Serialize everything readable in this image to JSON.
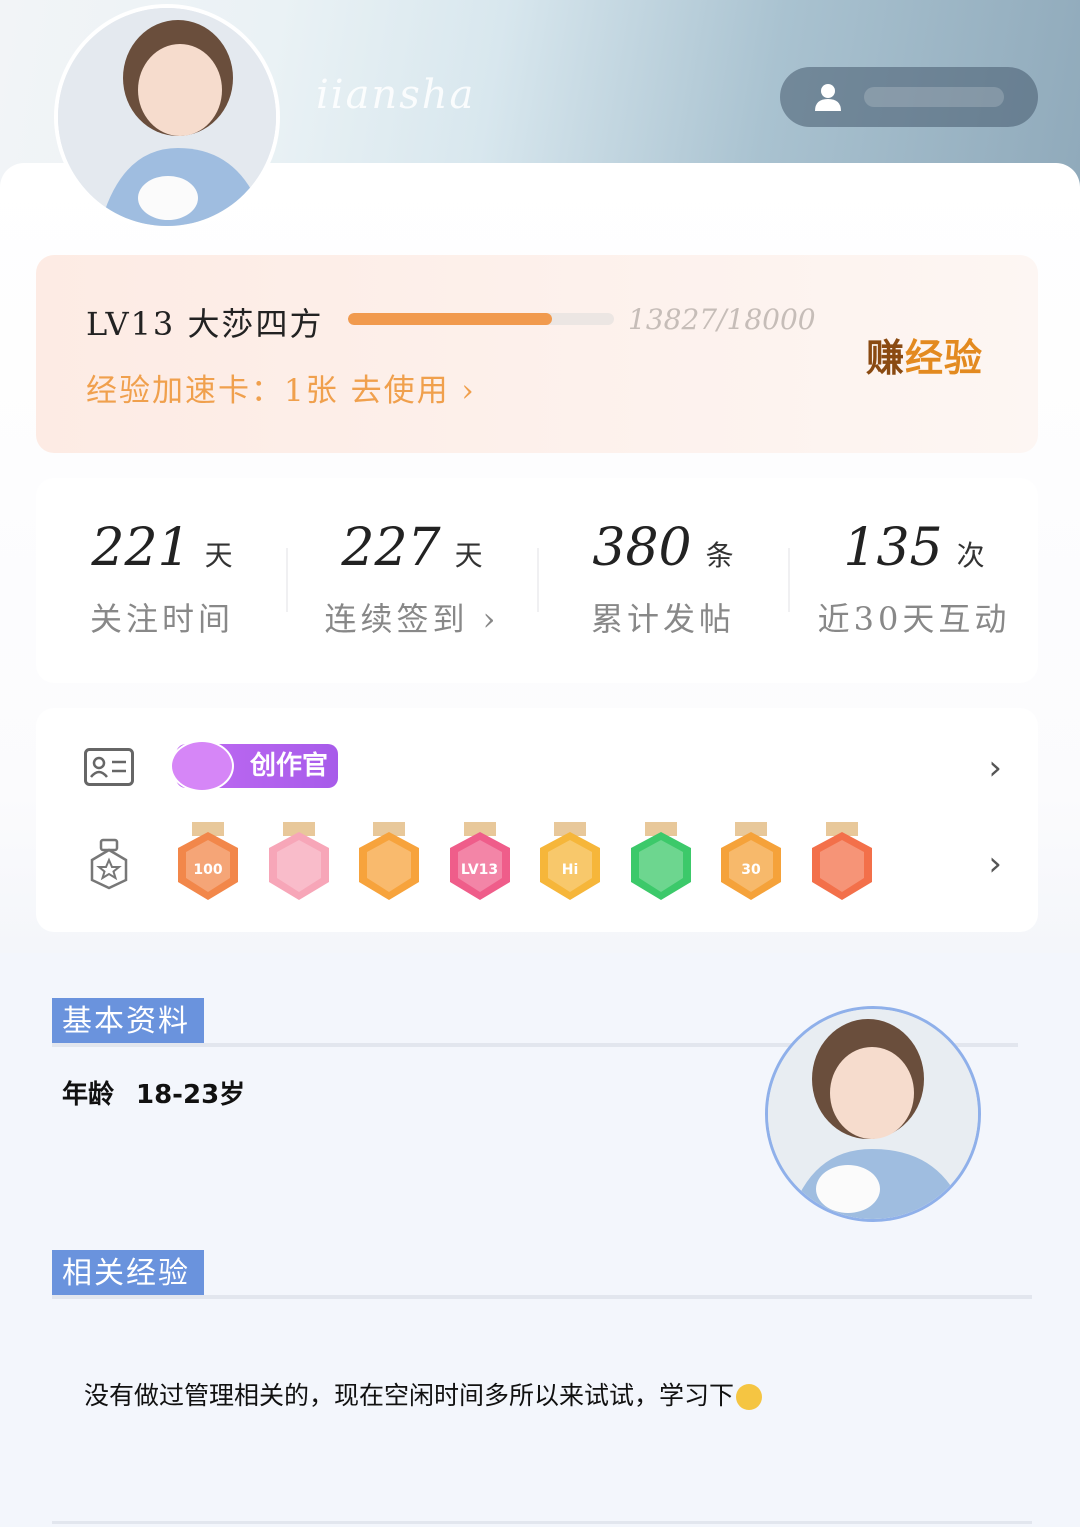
{
  "header": {
    "username": "iiansha"
  },
  "level": {
    "title": "LV13 大莎四方",
    "progress_value": "13827/18000",
    "progress_fraction": 0.768,
    "speed_card": "经验加速卡：1张 去使用 ›",
    "earn_label_first": "赚",
    "earn_label_rest": "经验"
  },
  "stats": [
    {
      "value": "221",
      "unit": "天",
      "label": "关注时间"
    },
    {
      "value": "227",
      "unit": "天",
      "label": "连续签到 ›"
    },
    {
      "value": "380",
      "unit": "条",
      "label": "累计发帖"
    },
    {
      "value": "135",
      "unit": "次",
      "label": "近30天互动"
    }
  ],
  "badges": {
    "creator_label": "创作官",
    "medals": [
      {
        "icon": "100-days-medal",
        "text": "100",
        "color": "#f2874a"
      },
      {
        "icon": "birthday-cake-medal",
        "text": "",
        "color": "#f7a6b8"
      },
      {
        "icon": "crown-medal",
        "text": "",
        "color": "#f7a33c"
      },
      {
        "icon": "lv13-medal",
        "text": "LV13",
        "color": "#ef5d8a"
      },
      {
        "icon": "hi-medal",
        "text": "Hi",
        "color": "#f6b63a"
      },
      {
        "icon": "hand-medal",
        "text": "",
        "color": "#3cc96a"
      },
      {
        "icon": "30-days-medal",
        "text": "30",
        "color": "#f5a23a"
      },
      {
        "icon": "rock-hand-medal",
        "text": "",
        "color": "#f3704a"
      }
    ]
  },
  "profile": {
    "section_basic": "基本资料",
    "age_label": "年龄",
    "age_value": "18-23岁",
    "section_exp": "相关经验",
    "exp_text": "没有做过管理相关的，现在空闲时间多所以来试试，学习下"
  },
  "colors": {
    "accent_blue": "#6a93dd",
    "progress_orange": "#f19a4e",
    "speed_orange": "#f0a04d"
  }
}
